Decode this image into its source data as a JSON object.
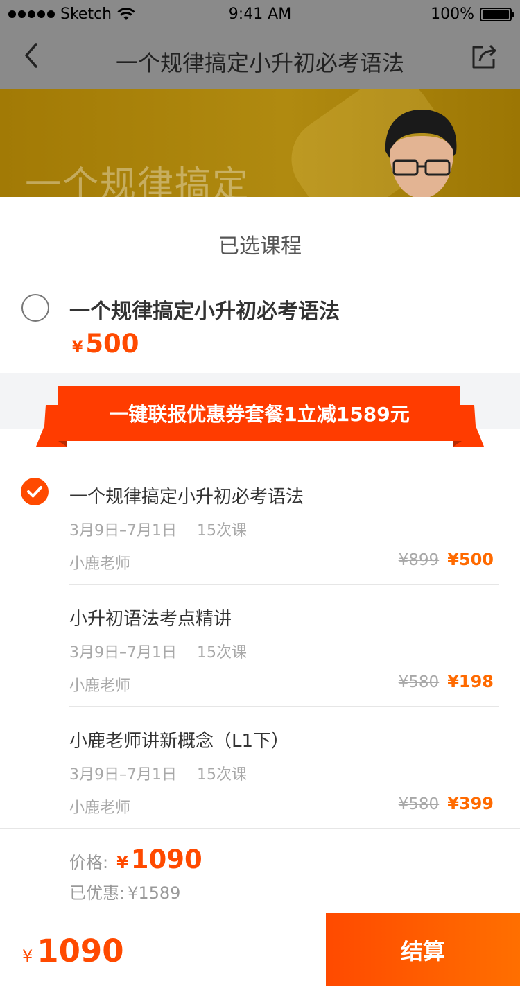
{
  "status_bar": {
    "carrier": "Sketch",
    "time": "9:41 AM",
    "battery": "100%"
  },
  "nav": {
    "title": "一个规律搞定小升初必考语法"
  },
  "banner": {
    "text": "一个规律搞定"
  },
  "sheet": {
    "title": "已选课程",
    "main_course": {
      "name": "一个规律搞定小升初必考语法",
      "currency": "¥",
      "price": "500",
      "selected": false
    },
    "promo_ribbon": "一键联报优惠券套餐1立减1589元",
    "courses": [
      {
        "name": "一个规律搞定小升初必考语法",
        "dates": "3月9日–7月1日",
        "lessons": "15次课",
        "teacher": "小鹿老师",
        "old_price": "¥899",
        "new_price": "¥500",
        "selected": true
      },
      {
        "name": "小升初语法考点精讲",
        "dates": "3月9日–7月1日",
        "lessons": "15次课",
        "teacher": "小鹿老师",
        "old_price": "¥580",
        "new_price": "¥198"
      },
      {
        "name": "小鹿老师讲新概念（L1下）",
        "dates": "3月9日–7月1日",
        "lessons": "15次课",
        "teacher": "小鹿老师",
        "old_price": "¥580",
        "new_price": "¥399"
      }
    ],
    "summary": {
      "price_label": "价格:",
      "currency": "¥",
      "price": "1090",
      "discount_label": "已优惠:",
      "discount": "¥1589"
    }
  },
  "bottom_bar": {
    "currency": "¥",
    "total": "1090",
    "checkout_label": "结算"
  },
  "colors": {
    "accent": "#ff4a00",
    "price_orange": "#ff6a00",
    "overlay_gray": "#8a8a8a"
  }
}
